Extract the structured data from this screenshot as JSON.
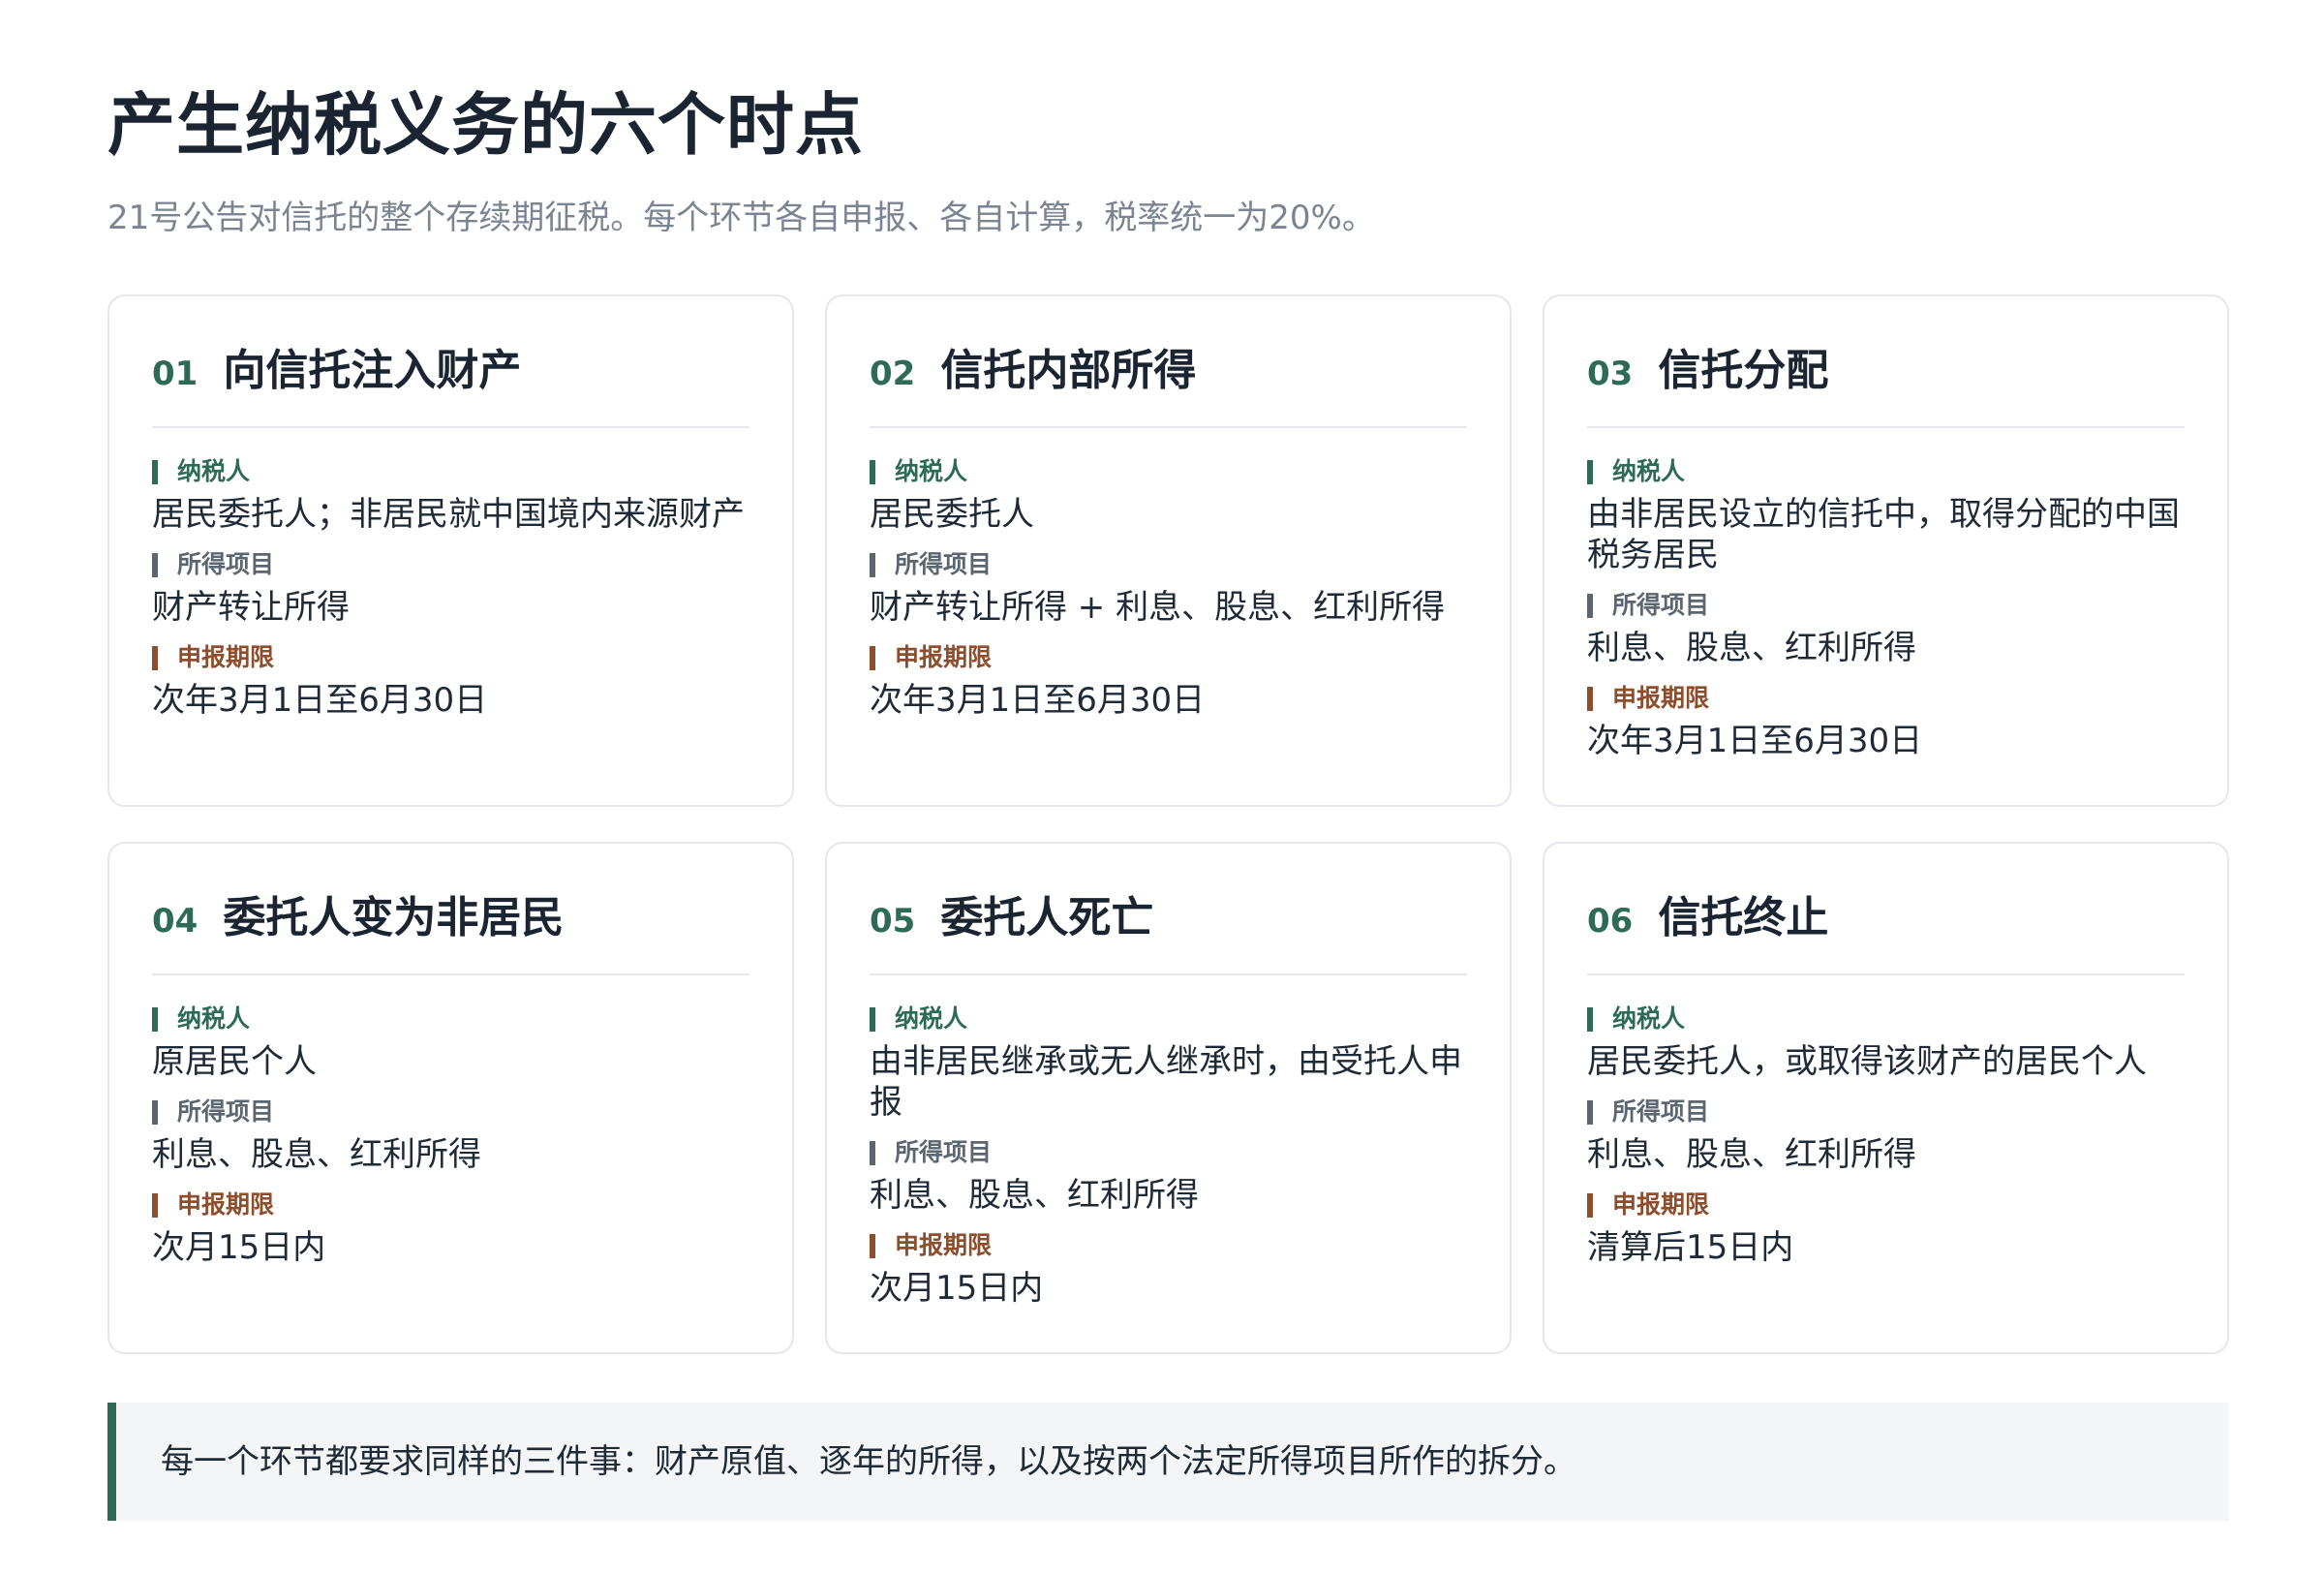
{
  "header": {
    "title": "产生纳税义务的六个时点",
    "subtitle": "21号公告对信托的整个存续期征税。每个环节各自申报、各自计算，税率统一为20%。"
  },
  "labels": {
    "payer": "纳税人",
    "item": "所得项目",
    "deadline": "申报期限"
  },
  "cards": [
    {
      "num": "01",
      "title": "向信托注入财产",
      "payer": "居民委托人；非居民就中国境内来源财产",
      "item": "财产转让所得",
      "deadline": "次年3月1日至6月30日"
    },
    {
      "num": "02",
      "title": "信托内部所得",
      "payer": "居民委托人",
      "item": "财产转让所得 + 利息、股息、红利所得",
      "deadline": "次年3月1日至6月30日"
    },
    {
      "num": "03",
      "title": "信托分配",
      "payer": "由非居民设立的信托中，取得分配的中国税务居民",
      "item": "利息、股息、红利所得",
      "deadline": "次年3月1日至6月30日"
    },
    {
      "num": "04",
      "title": "委托人变为非居民",
      "payer": "原居民个人",
      "item": "利息、股息、红利所得",
      "deadline": "次月15日内"
    },
    {
      "num": "05",
      "title": "委托人死亡",
      "payer": "由非居民继承或无人继承时，由受托人申报",
      "item": "利息、股息、红利所得",
      "deadline": "次月15日内"
    },
    {
      "num": "06",
      "title": "信托终止",
      "payer": "居民委托人，或取得该财产的居民个人",
      "item": "利息、股息、红利所得",
      "deadline": "清算后15日内"
    }
  ],
  "note": {
    "text": "每一个环节都要求同样的三件事：财产原值、逐年的所得，以及按两个法定所得项目所作的拆分。"
  },
  "colors": {
    "accent": "#2e6b57",
    "deadline": "#8d4e2e",
    "item": "#5c6670"
  }
}
